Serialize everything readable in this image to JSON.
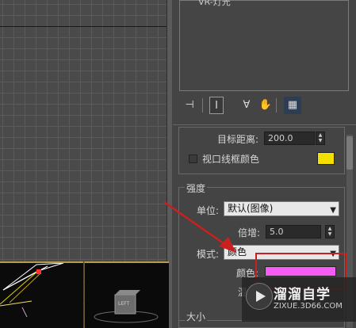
{
  "object_list": {
    "item_partial": "VR-灯光"
  },
  "toolbar": {
    "icons": [
      "pin-stack-icon",
      "show-end-result-icon",
      "make-unique-icon",
      "remove-modifier-icon",
      "configure-sets-icon"
    ]
  },
  "parameters": {
    "target_distance_label": "目标距离:",
    "target_distance_value": "200.0",
    "viewport_wire_color_label": "视口线框颜色",
    "viewport_wire_color_checked": false,
    "wire_color": "#f4e000"
  },
  "intensity": {
    "group_label": "强度",
    "unit_label": "单位:",
    "unit_value": "默认(图像)",
    "multiplier_label": "倍增:",
    "multiplier_value": "5.0",
    "mode_label": "模式:",
    "mode_value": "颜色",
    "color_label": "颜色:",
    "color_swatch": "#f45cf4",
    "temperature_label_partial": "温"
  },
  "size": {
    "group_label": "大小"
  },
  "annotation": {
    "highlight_color": "#c92020",
    "arrow_color": "#c92020"
  },
  "watermark": {
    "title": "溜溜自学",
    "url": "ZIXUE.3D66.COM"
  },
  "viewport": {
    "cube_label": "LEFT"
  }
}
